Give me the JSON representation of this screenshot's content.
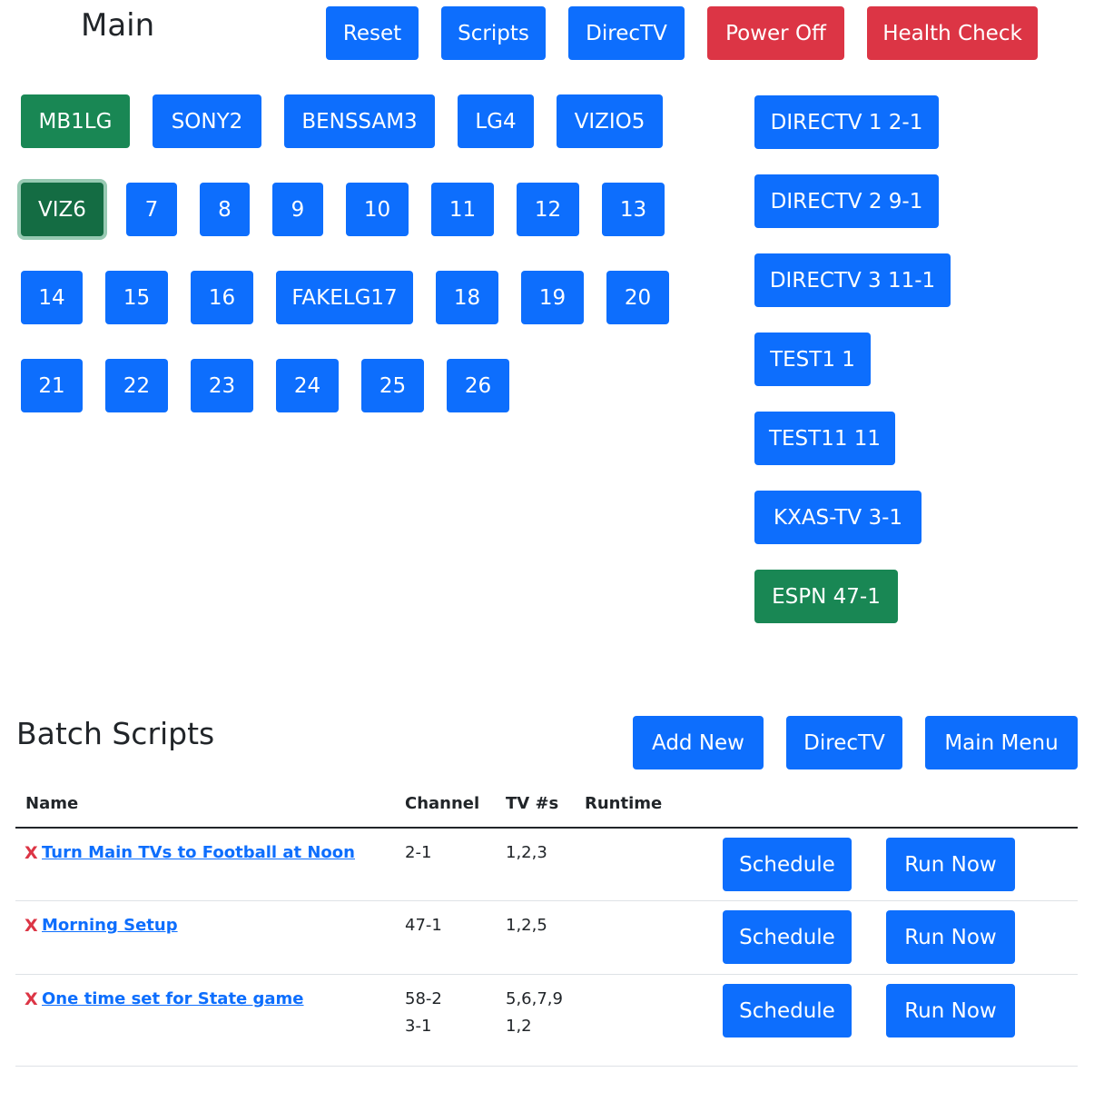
{
  "main": {
    "title": "Main",
    "top_buttons": {
      "reset": "Reset",
      "scripts": "Scripts",
      "directv": "DirecTV",
      "power_off": "Power Off",
      "health_check": "Health Check"
    },
    "tv_buttons": [
      {
        "label": "MB1LG",
        "style": "green"
      },
      {
        "label": "SONY2",
        "style": "blue"
      },
      {
        "label": "BENSSAM3",
        "style": "blue"
      },
      {
        "label": "LG4",
        "style": "blue"
      },
      {
        "label": "VIZIO5",
        "style": "blue"
      },
      {
        "label": "VIZ6",
        "style": "green-focused"
      },
      {
        "label": "7",
        "style": "blue"
      },
      {
        "label": "8",
        "style": "blue"
      },
      {
        "label": "9",
        "style": "blue"
      },
      {
        "label": "10",
        "style": "blue"
      },
      {
        "label": "11",
        "style": "blue"
      },
      {
        "label": "12",
        "style": "blue"
      },
      {
        "label": "13",
        "style": "blue"
      },
      {
        "label": "14",
        "style": "blue"
      },
      {
        "label": "15",
        "style": "blue"
      },
      {
        "label": "16",
        "style": "blue"
      },
      {
        "label": "FAKELG17",
        "style": "blue"
      },
      {
        "label": "18",
        "style": "blue"
      },
      {
        "label": "19",
        "style": "blue"
      },
      {
        "label": "20",
        "style": "blue"
      },
      {
        "label": "21",
        "style": "blue"
      },
      {
        "label": "22",
        "style": "blue"
      },
      {
        "label": "23",
        "style": "blue"
      },
      {
        "label": "24",
        "style": "blue"
      },
      {
        "label": "25",
        "style": "blue"
      },
      {
        "label": "26",
        "style": "blue"
      }
    ],
    "channel_buttons": [
      {
        "label": "DIRECTV 1 2-1",
        "style": "blue"
      },
      {
        "label": "DIRECTV 2 9-1",
        "style": "blue"
      },
      {
        "label": "DIRECTV 3 11-1",
        "style": "blue"
      },
      {
        "label": "TEST1 1",
        "style": "blue"
      },
      {
        "label": "TEST11 11",
        "style": "blue"
      },
      {
        "label": "KXAS-TV 3-1",
        "style": "blue"
      },
      {
        "label": "ESPN 47-1",
        "style": "green"
      }
    ]
  },
  "batch": {
    "title": "Batch Scripts",
    "buttons": {
      "add_new": "Add New",
      "directv": "DirecTV",
      "main_menu": "Main Menu"
    },
    "columns": [
      "Name",
      "Channel",
      "TV #s",
      "Runtime"
    ],
    "delete_glyph": "X",
    "schedule_label": "Schedule",
    "run_now_label": "Run Now",
    "rows": [
      {
        "name": "Turn Main TVs to Football at Noon",
        "channel": "2-1",
        "tvs": "1,2,3",
        "channel2": "",
        "tvs2": ""
      },
      {
        "name": "Morning Setup",
        "channel": "47-1",
        "tvs": "1,2,5",
        "channel2": "",
        "tvs2": ""
      },
      {
        "name": "One time set for State game",
        "channel": "58-2",
        "tvs": "5,6,7,9",
        "channel2": "3-1",
        "tvs2": "1,2"
      }
    ]
  },
  "colors": {
    "primary": "#0d6efd",
    "danger": "#dc3545",
    "success": "#198754",
    "success_dark": "#146c43",
    "text": "#212529"
  }
}
